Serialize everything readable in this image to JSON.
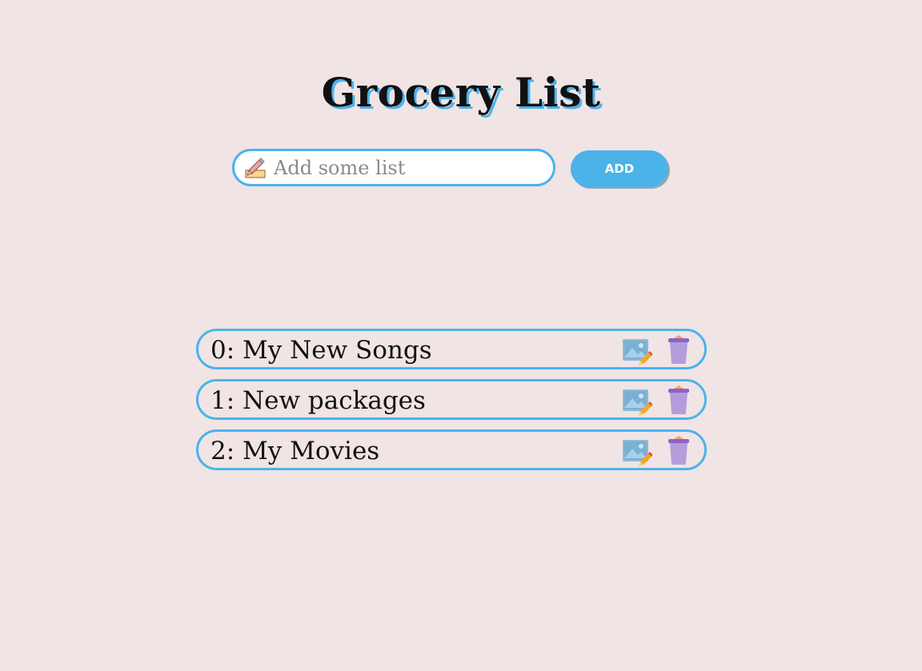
{
  "header": {
    "title": "Grocery List"
  },
  "add_form": {
    "placeholder": "Add some list",
    "value": "",
    "add_label": "ADD",
    "icon": "pencil-paper-icon"
  },
  "items": [
    {
      "label": "0: My New Songs",
      "edit_icon": "edit-image-icon",
      "delete_icon": "trash-icon"
    },
    {
      "label": "1: New packages",
      "edit_icon": "edit-image-icon",
      "delete_icon": "trash-icon"
    },
    {
      "label": "2: My Movies",
      "edit_icon": "edit-image-icon",
      "delete_icon": "trash-icon"
    }
  ],
  "colors": {
    "background": "#f0e4e5",
    "accent": "#4bb3ea",
    "trash": "#b39ddb",
    "text": "#111111"
  }
}
